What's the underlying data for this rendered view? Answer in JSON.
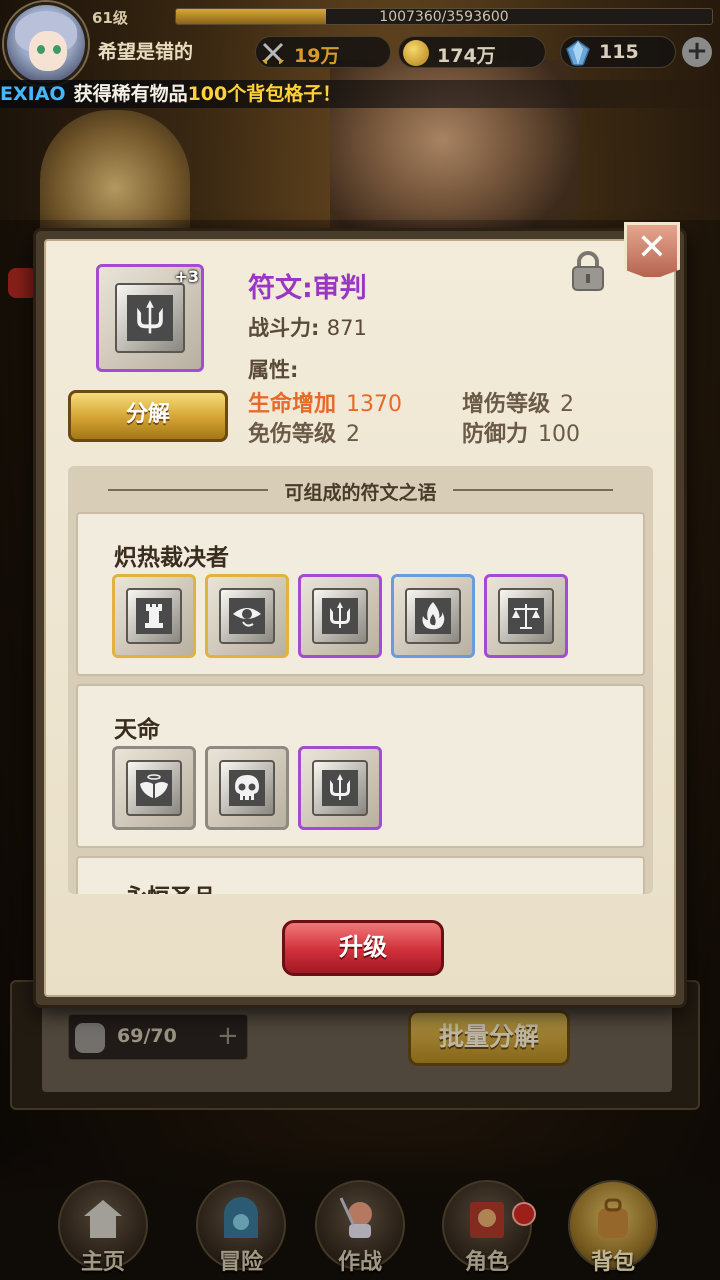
{
  "player": {
    "level": "61级",
    "name": "希望是错的",
    "exp_text": "1007360/3593600",
    "exp_ratio": 0.28
  },
  "resources": {
    "combat_power": "19万",
    "gold": "174万",
    "gems": "115"
  },
  "notice": {
    "player": "EXIAO",
    "message": "获得稀有物品",
    "item": "100个背包格子！"
  },
  "rune": {
    "title": "符文:审判",
    "power_label": "战斗力:",
    "power_value": "871",
    "plus": "+3",
    "attributes_label": "属性:",
    "attributes": [
      {
        "name": "生命增加",
        "value": "1370",
        "highlight": true
      },
      {
        "name": "增伤等级",
        "value": "2",
        "highlight": false
      },
      {
        "name": "免伤等级",
        "value": "2",
        "highlight": false
      },
      {
        "name": "防御力",
        "value": "100",
        "highlight": false
      }
    ],
    "decompose_label": "分解",
    "upgrade_label": "升级"
  },
  "runewords": {
    "header": "可组成的符文之语",
    "sets": [
      {
        "name": "炽热裁决者",
        "runes": [
          {
            "icon": "tower-icon",
            "frame": "gold"
          },
          {
            "icon": "eye-icon",
            "frame": "gold"
          },
          {
            "icon": "trident-icon",
            "frame": "purple"
          },
          {
            "icon": "flame-icon",
            "frame": "blue"
          },
          {
            "icon": "scales-icon",
            "frame": "purple"
          }
        ]
      },
      {
        "name": "天命",
        "runes": [
          {
            "icon": "angel-wings-icon",
            "frame": "plain"
          },
          {
            "icon": "skull-icon",
            "frame": "plain"
          },
          {
            "icon": "trident-icon",
            "frame": "purple"
          }
        ]
      },
      {
        "name": "永恒圣品",
        "runes": []
      }
    ]
  },
  "inventory": {
    "count": "69/70",
    "batch_label": "批量分解"
  },
  "nav": [
    {
      "label": "主页",
      "icon": "home-icon"
    },
    {
      "label": "冒险",
      "icon": "adventure-icon"
    },
    {
      "label": "作战",
      "icon": "battle-icon"
    },
    {
      "label": "角色",
      "icon": "character-icon"
    },
    {
      "label": "背包",
      "icon": "backpack-icon"
    }
  ],
  "colors": {
    "rune_title": "#9a36c4",
    "attr_highlight": "#e86a26",
    "upgrade_button": "#d0303a",
    "decompose_button": "#d2a232"
  }
}
